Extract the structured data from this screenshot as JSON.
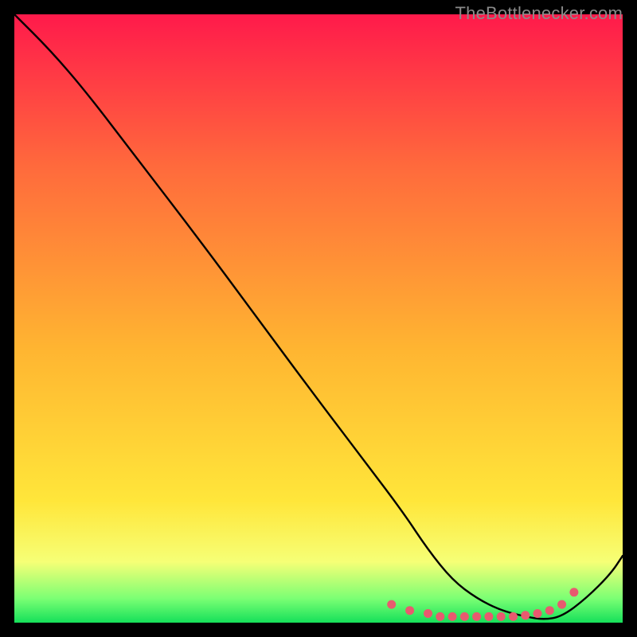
{
  "watermark": "TheBottlenecker.com",
  "colors": {
    "top": "#ff1a4b",
    "upper": "#ff6a3c",
    "mid": "#ffb531",
    "low": "#ffe63a",
    "lower": "#f6ff76",
    "green1": "#7cff74",
    "green2": "#15e05a",
    "curve": "#000000",
    "marker": "#e85a6f"
  },
  "chart_data": {
    "type": "line",
    "title": "",
    "xlabel": "",
    "ylabel": "",
    "xlim": [
      0,
      100
    ],
    "ylim": [
      0,
      100
    ],
    "grid": false,
    "series": [
      {
        "name": "bottleneck-curve",
        "x": [
          0,
          6,
          12,
          20,
          30,
          40,
          50,
          58,
          64,
          68,
          72,
          76,
          80,
          84,
          87,
          90,
          94,
          98,
          100
        ],
        "values": [
          100,
          94,
          87,
          76.5,
          63.5,
          50,
          36.5,
          26,
          18,
          12,
          7,
          4,
          2,
          1,
          0.5,
          1,
          4,
          8,
          11
        ]
      }
    ],
    "markers": {
      "name": "low-band-markers",
      "x": [
        62,
        65,
        68,
        70,
        72,
        74,
        76,
        78,
        80,
        82,
        84,
        86,
        88,
        90,
        92
      ],
      "values": [
        3,
        2,
        1.5,
        1,
        1,
        1,
        1,
        1,
        1,
        1,
        1.2,
        1.5,
        2,
        3,
        5
      ]
    }
  }
}
